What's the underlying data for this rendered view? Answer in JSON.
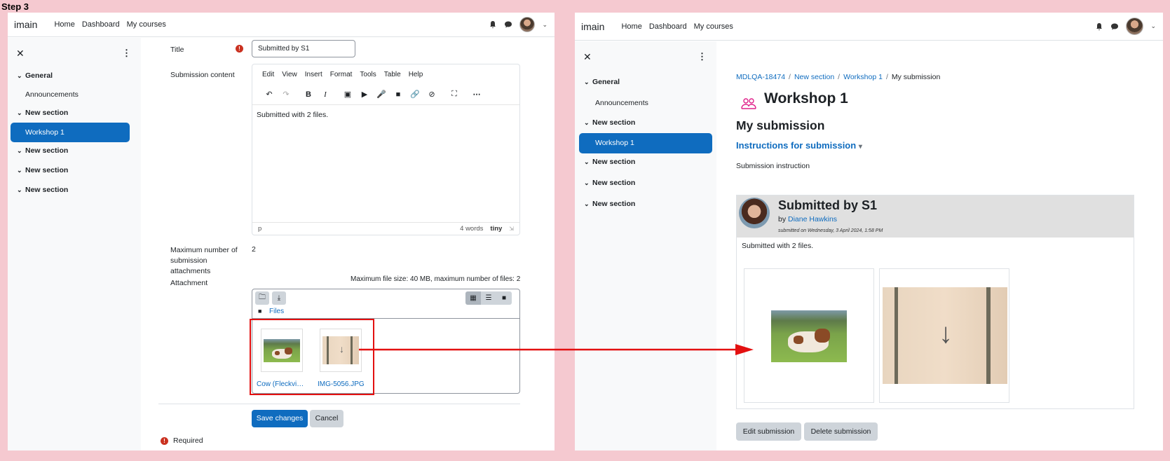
{
  "step_label": "Step 3",
  "navbar": {
    "brand": "imain",
    "links": [
      "Home",
      "Dashboard",
      "My courses"
    ]
  },
  "sidebar": {
    "items": [
      {
        "label": "General",
        "type": "section"
      },
      {
        "label": "Announcements",
        "type": "activity"
      },
      {
        "label": "New section",
        "type": "section"
      },
      {
        "label": "Workshop 1",
        "type": "activity",
        "active": true
      },
      {
        "label": "New section",
        "type": "section"
      },
      {
        "label": "New section",
        "type": "section"
      },
      {
        "label": "New section",
        "type": "section"
      }
    ]
  },
  "form": {
    "title_label": "Title",
    "title_value": "Submitted by S1",
    "content_label": "Submission content",
    "editor_menu": [
      "Edit",
      "View",
      "Insert",
      "Format",
      "Tools",
      "Table",
      "Help"
    ],
    "editor_content": "Submitted with 2 files.",
    "editor_path": "p",
    "editor_wordcount": "4 words",
    "editor_brand": "tiny",
    "max_attach_label": "Maximum number of submission attachments",
    "max_attach_value": "2",
    "attachment_label": "Attachment",
    "attachment_limits": "Maximum file size: 40 MB, maximum number of files: 2",
    "files_path": "Files",
    "files": [
      "Cow (Fleckvi…",
      "IMG-5056.JPG"
    ],
    "save_label": "Save changes",
    "cancel_label": "Cancel",
    "required_label": "Required"
  },
  "right": {
    "breadcrumb": [
      "MDLQA-18474",
      "New section",
      "Workshop 1",
      "My submission"
    ],
    "page_title": "Workshop 1",
    "subheading": "My submission",
    "instructions_link": "Instructions for submission",
    "instructions_text": "Submission instruction",
    "submission": {
      "title": "Submitted by S1",
      "by_prefix": "by",
      "author": "Diane Hawkins",
      "date": "submitted on Wednesday, 3 April 2024, 1:58 PM",
      "text": "Submitted with 2 files."
    },
    "edit_label": "Edit submission",
    "delete_label": "Delete submission"
  },
  "colors": {
    "primary": "#0f6cbf",
    "highlight": "#e31010",
    "background": "#f5c9d0"
  }
}
